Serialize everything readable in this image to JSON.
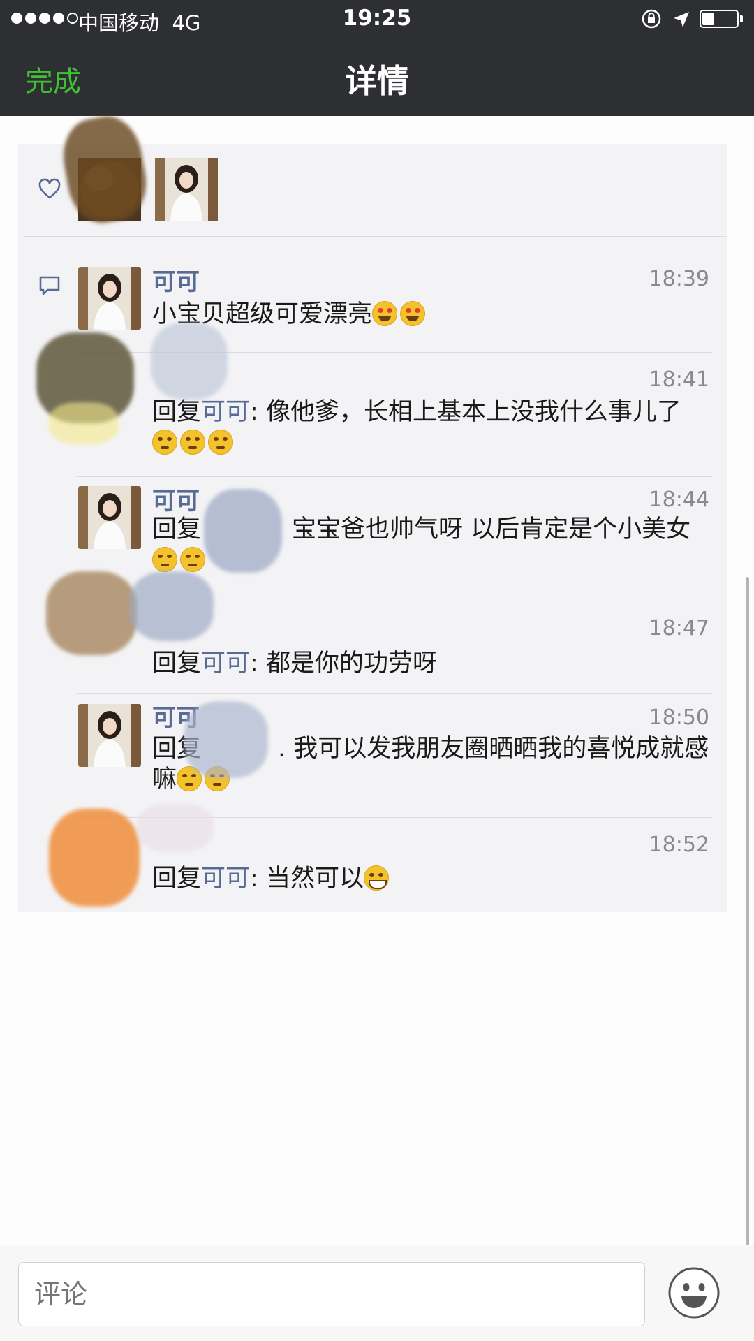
{
  "status_bar": {
    "carrier": "中国移动",
    "network": "4G",
    "time": "19:25",
    "battery_level": 0.35
  },
  "nav": {
    "done_label": "完成",
    "title": "详情"
  },
  "comments": [
    {
      "name": "可可",
      "time": "18:39",
      "text": "小宝贝超级可爱漂亮",
      "emojis": [
        "heart-eyes",
        "heart-eyes"
      ]
    },
    {
      "name": "",
      "time": "18:41",
      "reply_label": "回复",
      "mention": "可可",
      "text": ": 像他爹，长相上基本上没我什么事儿了",
      "emojis": [
        "think",
        "think",
        "think"
      ]
    },
    {
      "name": "可可",
      "time": "18:44",
      "reply_label": "回复",
      "mention": "",
      "text": "宝宝爸也帅气呀 以后肯定是个小美女",
      "emojis": [
        "think",
        "think"
      ]
    },
    {
      "name": "",
      "time": "18:47",
      "reply_label": "回复",
      "mention": "可可",
      "text": ": 都是你的功劳呀",
      "emojis": []
    },
    {
      "name": "可可",
      "time": "18:50",
      "reply_label": "回复",
      "mention": "",
      "text": ". 我可以发我朋友圈晒晒我的喜悦成就感嘛",
      "emojis": [
        "think",
        "think"
      ]
    },
    {
      "name": "",
      "time": "18:52",
      "reply_label": "回复",
      "mention": "可可",
      "text": ": 当然可以",
      "emojis": [
        "grin"
      ]
    }
  ],
  "input": {
    "placeholder": "评论"
  },
  "colors": {
    "nav_bg": "#2e2f33",
    "accent_green": "#41c035",
    "link_blue": "#576b95"
  }
}
